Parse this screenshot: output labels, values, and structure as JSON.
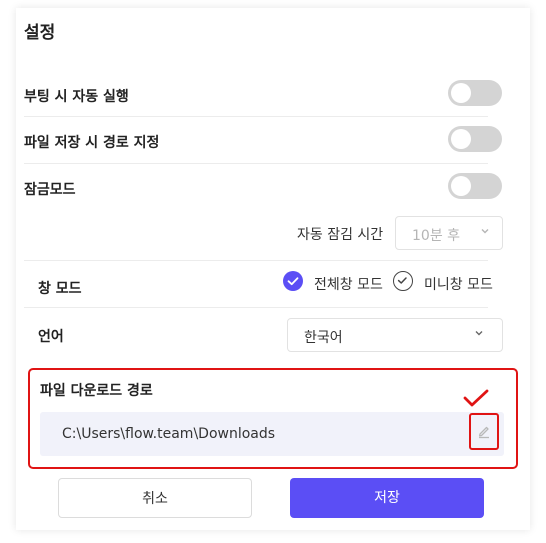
{
  "dialog": {
    "title": "설정"
  },
  "settings": {
    "auto_run": {
      "label": "부팅 시 자동 실행",
      "enabled": false
    },
    "save_path": {
      "label": "파일 저장 시 경로 지정",
      "enabled": false
    },
    "lock_mode": {
      "label": "잠금모드",
      "enabled": false
    },
    "auto_lock": {
      "label": "자동 잠김 시간",
      "value": "10분 후"
    },
    "window_mode": {
      "label": "창 모드",
      "options": [
        {
          "label": "전체창 모드",
          "selected": true
        },
        {
          "label": "미니창 모드",
          "selected": false
        }
      ]
    },
    "language": {
      "label": "언어",
      "value": "한국어"
    },
    "download_path": {
      "label": "파일 다운로드 경로",
      "value": "C:\\Users\\flow.team\\Downloads"
    }
  },
  "buttons": {
    "cancel": "취소",
    "save": "저장"
  },
  "colors": {
    "accent": "#5b4ef5",
    "annotation": "#e01414",
    "toggle_off": "#d4d4d4"
  },
  "icons": {
    "edit": "pencil-icon",
    "chevron": "chevron-down-icon",
    "check": "check-icon"
  }
}
